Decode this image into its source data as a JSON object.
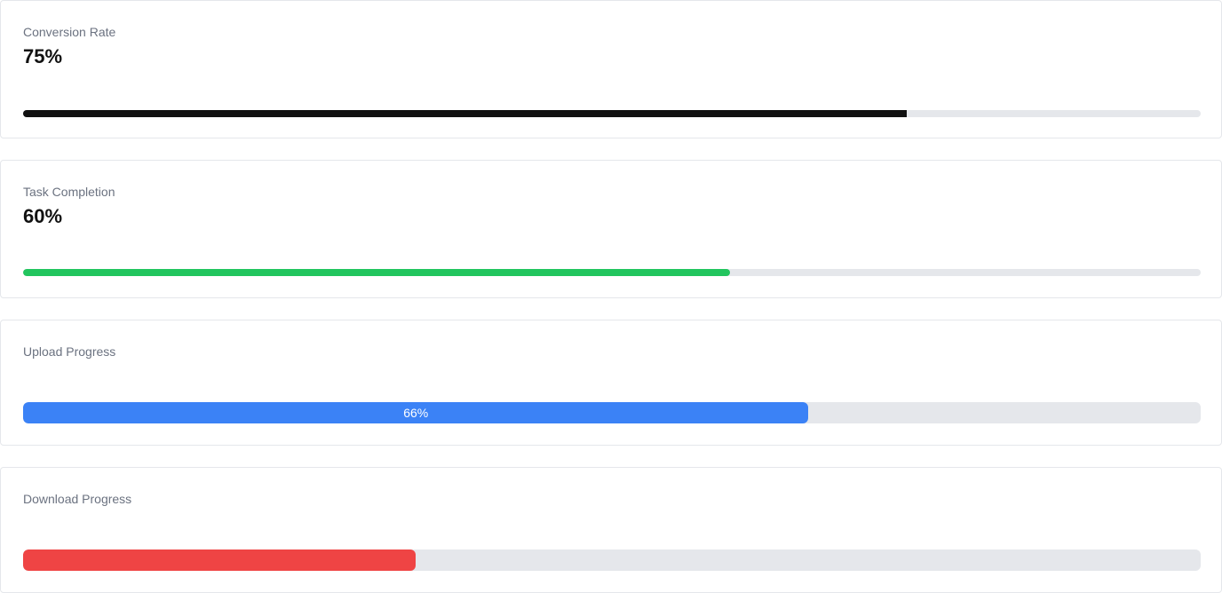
{
  "cards": [
    {
      "label": "Conversion Rate",
      "value": "75%",
      "progress_percent": 75,
      "color": "#111111"
    },
    {
      "label": "Task Completion",
      "value": "60%",
      "progress_percent": 60,
      "color": "#22c55e"
    },
    {
      "label": "Upload Progress",
      "progress_text": "66%",
      "progress_percent": 66.7,
      "color": "#3b82f6"
    },
    {
      "label": "Download Progress",
      "progress_percent": 33.3,
      "color": "#ef4444"
    }
  ]
}
